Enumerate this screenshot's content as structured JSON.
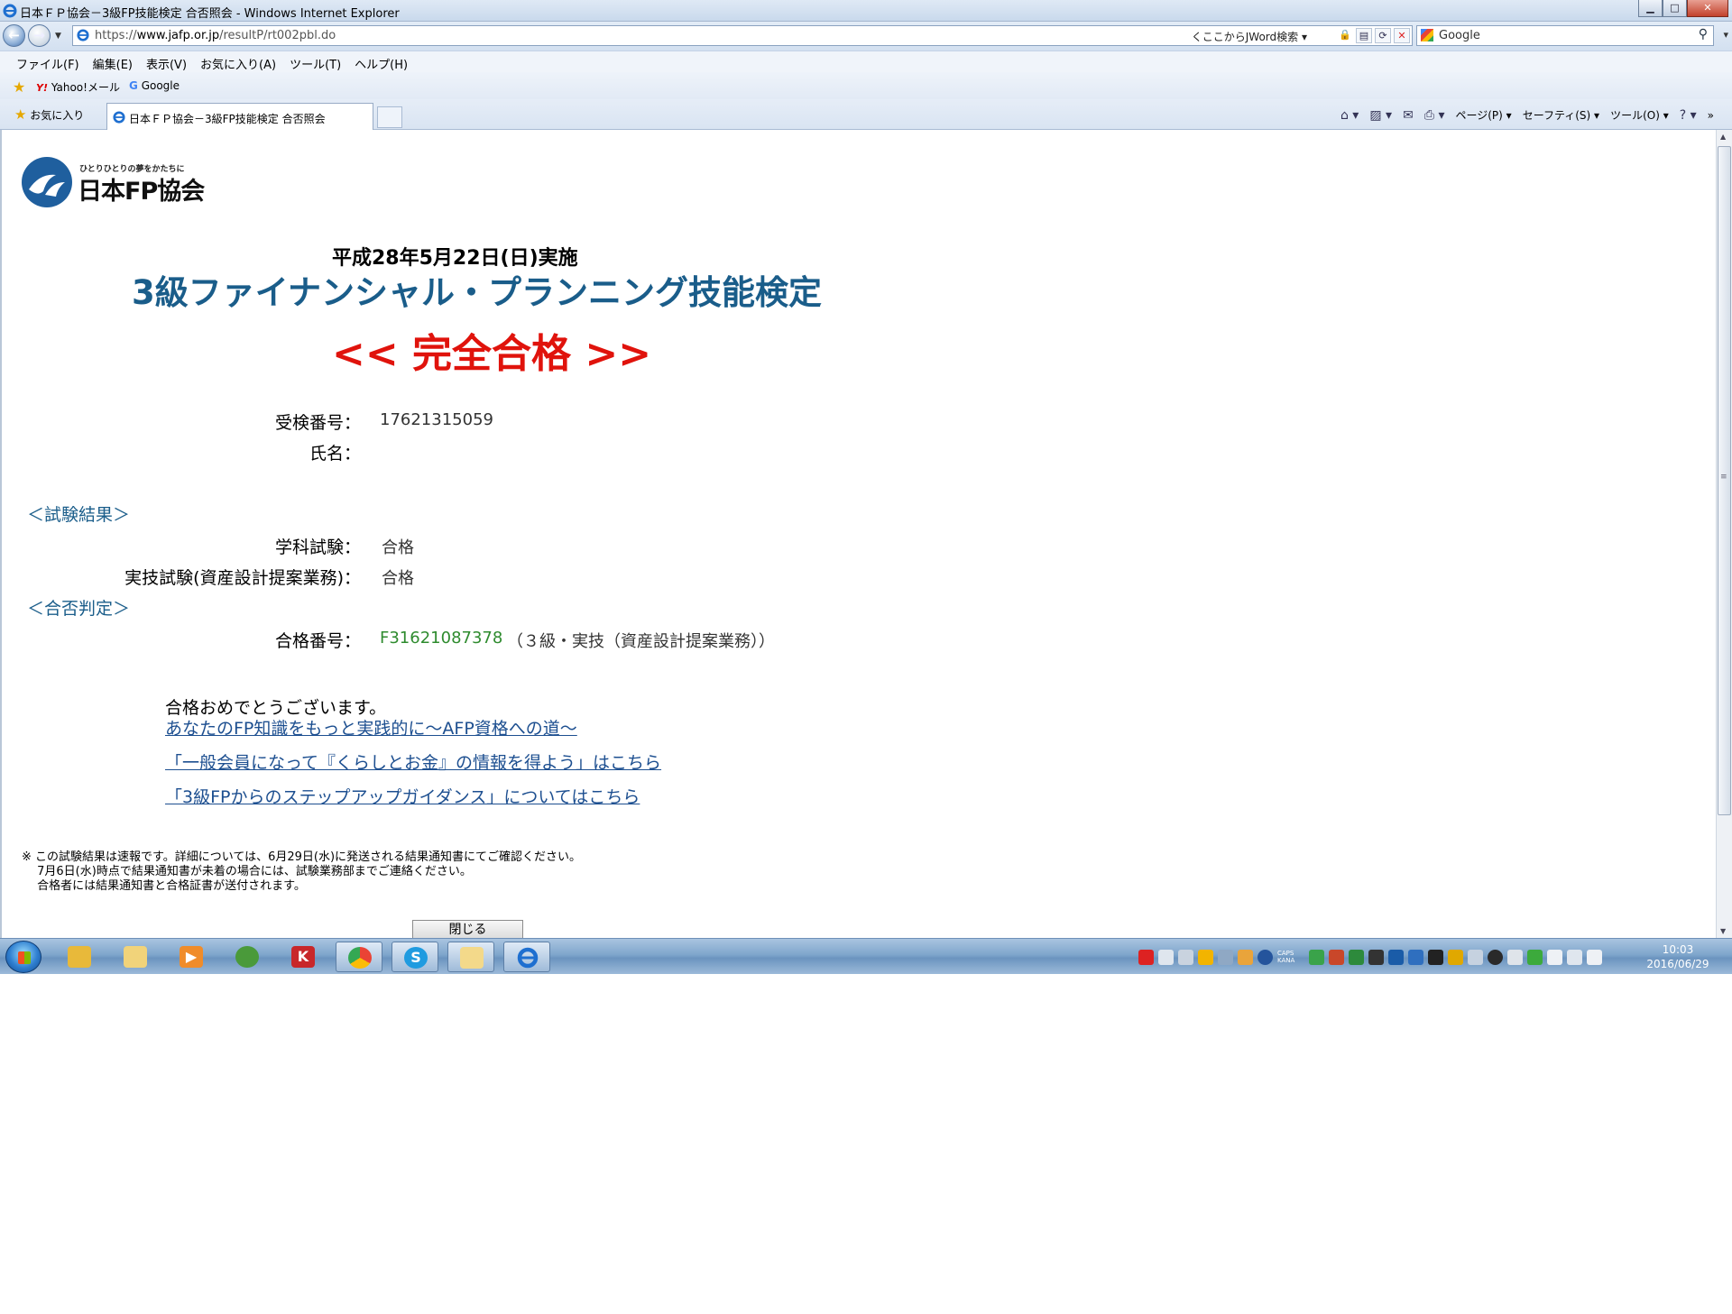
{
  "window": {
    "title": "日本ＦＰ協会－3級FP技能検定  合否照会 - Windows Internet Explorer",
    "controls": {
      "minimize": "▁",
      "maximize": "□",
      "close": "✕"
    }
  },
  "address_bar": {
    "url_prefix": "https://",
    "url_domain": "www.jafp.or.jp",
    "url_path": "/resultP/rt002pbl.do",
    "jword_label": "くここからJWord検索",
    "search_engine": "Google"
  },
  "menu": {
    "items": [
      "ファイル(F)",
      "編集(E)",
      "表示(V)",
      "お気に入り(A)",
      "ツール(T)",
      "ヘルプ(H)"
    ]
  },
  "links_bar": {
    "yahoo_mark": "Y!",
    "yahoo_label": "Yahoo!メール",
    "google_mark": "G",
    "google_label": "Google"
  },
  "tabs": {
    "favorites_label": "お気に入り",
    "active_tab_label": "日本ＦＰ協会－3級FP技能検定  合否照会"
  },
  "command_bar": {
    "page": "ページ(P) ▾",
    "safety": "セーフティ(S) ▾",
    "tools": "ツール(O) ▾",
    "more": "»"
  },
  "page": {
    "logo_tagline": "ひとりひとりの夢をかたちに",
    "logo_name": "日本FP協会",
    "exam_date": "平成28年5月22日(日)実施",
    "exam_title": "3級ファイナンシャル・プランニング技能検定",
    "result_banner": "<< 完全合格 >>",
    "examinee_no_label": "受検番号：",
    "examinee_no": "17621315059",
    "name_label": "氏名：",
    "section_results": "＜試験結果＞",
    "written_label": "学科試験：",
    "written_result": "合格",
    "practical_label": "実技試験(資産設計提案業務)：",
    "practical_result": "合格",
    "section_judgement": "＜合否判定＞",
    "cert_no_label": "合格番号：",
    "cert_no": "F31621087378",
    "cert_desc": "（３級・実技（資産設計提案業務））",
    "congrats": "合格おめでとうございます。",
    "link_afp": "あなたのFP知識をもっと実践的に～AFP資格への道～",
    "link_member": "「一般会員になって『くらしとお金』の情報を得よう」はこちら",
    "link_guidance": "「3級FPからのステップアップガイダンス」についてはこちら",
    "note_line1": "※ この試験結果は速報です。詳細については、6月29日(水)に発送される結果通知書にてご確認ください。",
    "note_line2": "　 7月6日(水)時点で結果通知書が未着の場合には、試験業務部までご連絡ください。",
    "note_line3": "　 合格者には結果通知書と合格証書が送付されます。",
    "close_button": "閉じる"
  },
  "taskbar": {
    "apps": [
      "explorer-folder",
      "media-player",
      "bonsai-app",
      "kingsoft-app",
      "chrome",
      "skype",
      "folder-window",
      "internet-explorer"
    ],
    "skype_letter": "S",
    "kingsoft_letter": "K",
    "clock_time": "10:03",
    "clock_date": "2016/06/29",
    "tray_caps": "CAPS",
    "tray_kana": "KANA"
  },
  "colors": {
    "title_blue": "#1a5d8a",
    "pass_red": "#e0130c",
    "cert_green": "#2e8b2e",
    "link_blue": "#1d4f90"
  }
}
